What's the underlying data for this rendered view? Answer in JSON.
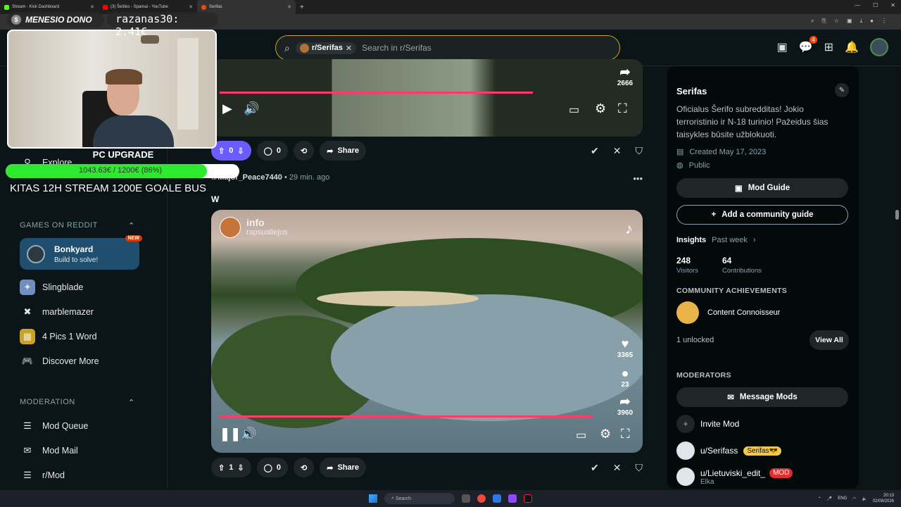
{
  "browser": {
    "tabs": [
      {
        "title": "Stream - Kick Dashboard",
        "color": "#53fc18"
      },
      {
        "title": "(3) Šeštės - Spamai - YouTube",
        "color": "#ff0000"
      },
      {
        "title": "Serifas",
        "color": "#ff4500"
      }
    ]
  },
  "overlay": {
    "dono_label": "MENESIO DONO",
    "dono_value": "razanas30: 2.41€",
    "pc_upgrade": "PC UPGRADE",
    "goal_text": "1043.63€ / 1200€ (86%)",
    "goal_progress": 0.86,
    "kitas": "KITAS 12H STREAM 1200E GOALE BUS"
  },
  "search": {
    "subreddit_chip": "r/Serifas",
    "placeholder": "Search in r/Serifas"
  },
  "header": {
    "notifications_badge": "4"
  },
  "sidebar": {
    "explore": "Explore",
    "games_heading": "GAMES ON REDDIT",
    "bonkyard": {
      "title": "Bonkyard",
      "subtitle": "Build to solve!",
      "badge": "NEW"
    },
    "games": [
      "Slingblade",
      "marblemazer",
      "4 Pics 1 Word",
      "Discover More"
    ],
    "moderation_heading": "MODERATION",
    "moderation": [
      "Mod Queue",
      "Mod Mail",
      "r/Mod"
    ]
  },
  "post1": {
    "share_count": "2666",
    "votes": "0",
    "comments": "0",
    "share_label": "Share"
  },
  "post2": {
    "author": "Major_Peace7440",
    "time": "29 min. ago",
    "title": "W",
    "video_user": "info",
    "video_handle": "rapsualiejus",
    "likes": "3365",
    "video_comments": "23",
    "video_shares": "3960",
    "votes": "1",
    "comments": "0",
    "share_label": "Share"
  },
  "community": {
    "name": "Serifas",
    "description": "Oficialus Šerifo subredditas! Jokio terroristinio ir N-18 turinio! Pažeidus šias taisykles būsite užblokuoti.",
    "created": "Created May 17, 2023",
    "visibility": "Public",
    "mod_guide": "Mod Guide",
    "add_guide": "Add a community guide",
    "insights": "Insights",
    "insights_period": "Past week",
    "visitors_value": "248",
    "visitors_label": "Visitors",
    "contrib_value": "64",
    "contrib_label": "Contributions",
    "achievements_heading": "COMMUNITY ACHIEVEMENTS",
    "achievement": "Content Connoisseur",
    "unlocked": "1 unlocked",
    "view_all": "View All",
    "moderators_heading": "MODERATORS",
    "message_mods": "Message Mods",
    "invite_mod": "Invite Mod",
    "mods": [
      {
        "name": "u/Serifass",
        "flair": "Serifas😎"
      },
      {
        "name": "u/Lietuviski_edit_",
        "flair": "MOD",
        "sub": "Elka"
      }
    ]
  },
  "taskbar": {
    "search_placeholder": "Search",
    "lang": "ENG",
    "time": "20:13",
    "date": "02/08/2026"
  }
}
